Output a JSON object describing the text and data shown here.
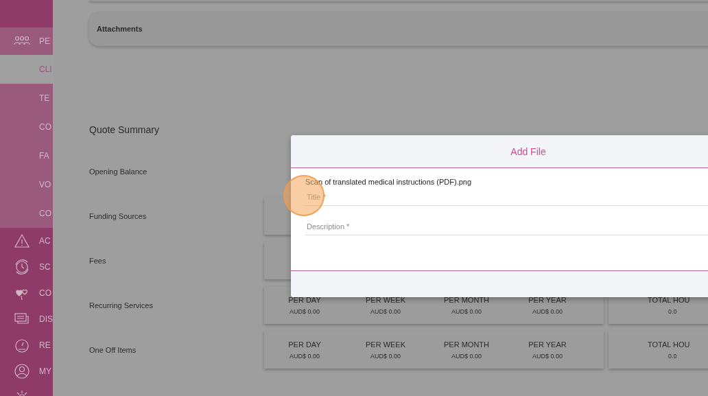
{
  "sidebar": {
    "items": [
      {
        "label": "PE",
        "expanded": true,
        "children": [
          {
            "label": "CLI",
            "selected": true
          },
          {
            "label": "TE",
            "selected": false
          },
          {
            "label": "CO",
            "selected": false
          },
          {
            "label": "FA",
            "selected": false
          },
          {
            "label": "VO",
            "selected": false
          },
          {
            "label": "CO",
            "selected": false
          }
        ]
      },
      {
        "label": "AC"
      },
      {
        "label": "SC"
      },
      {
        "label": "CO"
      },
      {
        "label": "DIS"
      },
      {
        "label": "RE"
      },
      {
        "label": "MY"
      }
    ]
  },
  "attachments_card": {
    "title": "Attachments"
  },
  "quote_summary": {
    "title": "Quote Summary",
    "rows": [
      {
        "label": "Opening Balance",
        "kind": "plain"
      },
      {
        "label": "Funding Sources",
        "kind": "cards"
      },
      {
        "label": "Fees",
        "kind": "cards"
      },
      {
        "label": "Recurring Services",
        "kind": "amounts",
        "periods": [
          {
            "label": "PER DAY",
            "value": "AUD$ 0.00"
          },
          {
            "label": "PER WEEK",
            "value": "AUD$ 0.00"
          },
          {
            "label": "PER MONTH",
            "value": "AUD$ 0.00"
          },
          {
            "label": "PER YEAR",
            "value": "AUD$ 0.00"
          }
        ],
        "total": {
          "label": "TOTAL HOU",
          "value": "0.0"
        }
      },
      {
        "label": "One Off Items",
        "kind": "amounts",
        "periods": [
          {
            "label": "PER DAY",
            "value": "AUD$ 0.00"
          },
          {
            "label": "PER WEEK",
            "value": "AUD$ 0.00"
          },
          {
            "label": "PER MONTH",
            "value": "AUD$ 0.00"
          },
          {
            "label": "PER YEAR",
            "value": "AUD$ 0.00"
          }
        ],
        "total": {
          "label": "TOTAL HOU",
          "value": "0.0"
        }
      }
    ]
  },
  "modal": {
    "title": "Add File",
    "file_name": "Scan of translated medical instructions (PDF).png",
    "fields": [
      {
        "placeholder": "Title *"
      },
      {
        "placeholder": "Description *"
      }
    ]
  }
}
